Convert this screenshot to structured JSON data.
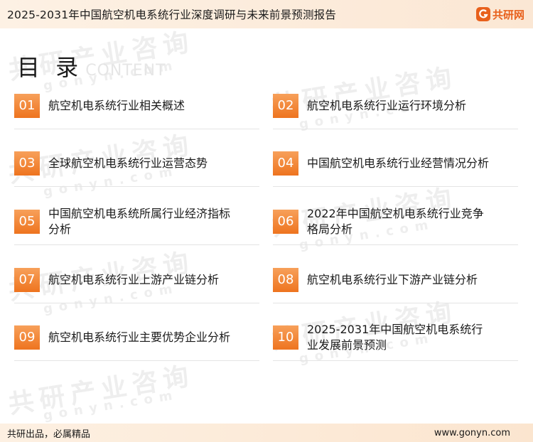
{
  "header": {
    "title": "2025-2031年中国航空机电系统行业深度调研与未来前景预测报告",
    "logo_text": "共研网"
  },
  "toc": {
    "title": "目 录",
    "subtitle": "CONTENT",
    "items": [
      {
        "num": "01",
        "label": "航空机电系统行业相关概述"
      },
      {
        "num": "02",
        "label": "航空机电系统行业运行环境分析"
      },
      {
        "num": "03",
        "label": "全球航空机电系统行业运营态势"
      },
      {
        "num": "04",
        "label": "中国航空机电系统行业经营情况分析"
      },
      {
        "num": "05",
        "label": "中国航空机电系统所属行业经济指标分析"
      },
      {
        "num": "06",
        "label": "2022年中国航空机电系统行业竞争格局分析"
      },
      {
        "num": "07",
        "label": "航空机电系统行业上游产业链分析"
      },
      {
        "num": "08",
        "label": "航空机电系统行业下游产业链分析"
      },
      {
        "num": "09",
        "label": "航空机电系统行业主要优势企业分析"
      },
      {
        "num": "10",
        "label": "2025-2031年中国航空机电系统行业发展前景预测"
      }
    ]
  },
  "watermark": {
    "cn": "共研产业咨询",
    "en": "gonyn.com"
  },
  "footer": {
    "left": "共研出品，必属精品",
    "right": "www.gonyn.com"
  },
  "colors": {
    "accent": "#ee741f",
    "header_bg": "#fdf1e4"
  }
}
